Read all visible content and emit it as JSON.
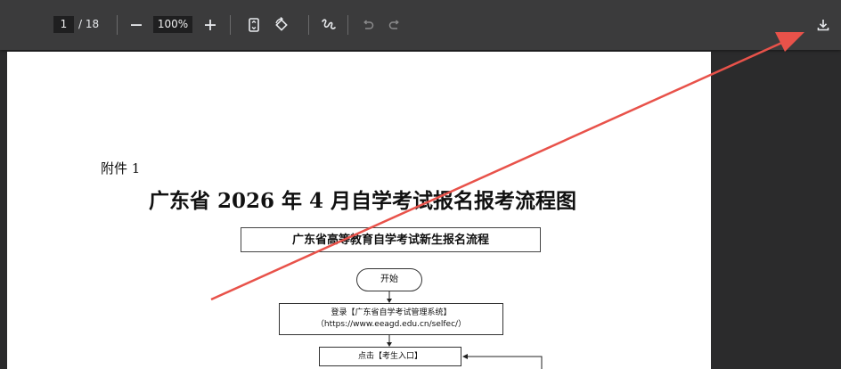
{
  "toolbar": {
    "page_current": "1",
    "page_total": "/ 18",
    "zoom_value": "100%",
    "icons": [
      "zoom-out-icon",
      "zoom-in-icon",
      "fit-page-icon",
      "rotate-icon",
      "draw-icon",
      "undo-icon",
      "redo-icon",
      "download-icon"
    ]
  },
  "document": {
    "attachment_label": "附件 1",
    "title": "广东省 2026 年 4 月自学考试报名报考流程图",
    "flow_header": "广东省高等教育自学考试新生报名流程",
    "start_label": "开始",
    "login_line1": "登录【广东省自学考试管理系统】",
    "login_line2": "（https://www.eeagd.edu.cn/selfec/）",
    "click_label": "点击【考生入口】"
  },
  "colors": {
    "toolbar_bg": "#3b3b3c",
    "viewer_bg": "#2b2b2c",
    "annotation_arrow": "#e8524a"
  }
}
